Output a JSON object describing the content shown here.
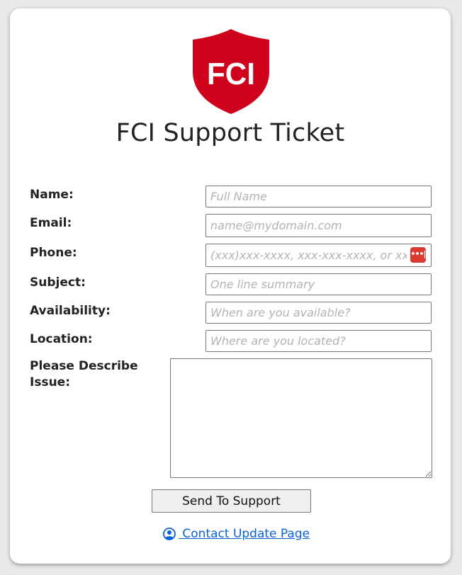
{
  "title": "FCI Support Ticket",
  "logo": {
    "text": "FCI",
    "color": "#d0021b"
  },
  "form": {
    "name": {
      "label": "Name:",
      "placeholder": "Full Name"
    },
    "email": {
      "label": "Email:",
      "placeholder": "name@mydomain.com"
    },
    "phone": {
      "label": "Phone:",
      "placeholder": "(xxx)xxx-xxxx, xxx-xxx-xxxx, or xxxxxxxxxx",
      "badge": "•••|"
    },
    "subject": {
      "label": "Subject:",
      "placeholder": "One line summary"
    },
    "availability": {
      "label": "Availability:",
      "placeholder": "When are you available?"
    },
    "location": {
      "label": "Location:",
      "placeholder": "Where are you located?"
    },
    "issue": {
      "label_line1": "Please Describe",
      "label_line2": "Issue:"
    }
  },
  "submit_label": "Send To Support",
  "contact_link": {
    "label": " Contact Update Page",
    "icon": "user-circle-icon"
  },
  "colors": {
    "accent": "#d0021b",
    "link": "#0a62d8",
    "background": "#e9e9e9"
  }
}
